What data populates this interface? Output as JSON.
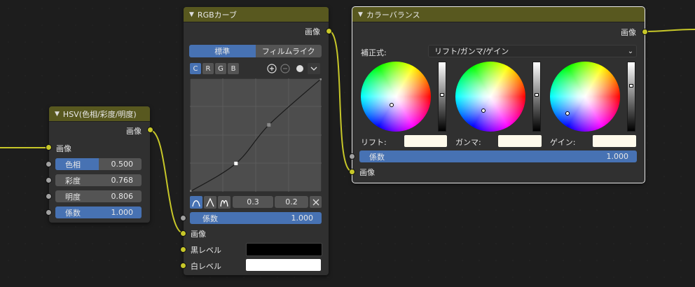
{
  "colors": {
    "header": "#58581f",
    "node_bg": "#303030",
    "accent_blue": "#4772b3",
    "socket_yellow": "#c7c729",
    "socket_grey": "#a1a1a1",
    "wire": "#c7c729",
    "background": "#1d1d1d"
  },
  "hsv_node": {
    "title": "HSV(色相/彩度/明度)",
    "output_label": "画像",
    "input_image_label": "画像",
    "fields": [
      {
        "label": "色相",
        "value": "0.500",
        "fraction": 0.5
      },
      {
        "label": "彩度",
        "value": "0.768",
        "fraction": 0.0
      },
      {
        "label": "明度",
        "value": "0.806",
        "fraction": 0.0
      },
      {
        "label": "係数",
        "value": "1.000",
        "fraction": 1.0
      }
    ]
  },
  "rgb_node": {
    "title": "RGBカーブ",
    "output_label": "画像",
    "tabs": [
      "標準",
      "フィルムライク"
    ],
    "active_tab": "標準",
    "channels": [
      "C",
      "R",
      "G",
      "B"
    ],
    "active_channel": "C",
    "icons": [
      "zoom-in-icon",
      "zoom-out-icon",
      "circle-icon",
      "chevron-down-icon"
    ],
    "curve_points": [
      [
        0.0,
        0.0
      ],
      [
        0.35,
        0.25
      ],
      [
        0.6,
        0.59
      ],
      [
        1.0,
        1.0
      ]
    ],
    "handle_values": [
      "0.3",
      "0.2"
    ],
    "factor": {
      "label": "係数",
      "value": "1.000"
    },
    "input_image_label": "画像",
    "black_level_label": "黒レベル",
    "white_level_label": "白レベル",
    "black_color": "#000000",
    "white_color": "#ffffff"
  },
  "color_balance_node": {
    "title": "カラーバランス",
    "output_label": "画像",
    "formula_label": "補正式:",
    "formula_value": "リフト/ガンマ/ゲイン",
    "wheels": [
      {
        "label": "リフト:",
        "slider_level": 0.47,
        "swatch": "#fffaeb"
      },
      {
        "label": "ガンマ:",
        "slider_level": 0.47,
        "swatch": "#fffaeb"
      },
      {
        "label": "ゲイン:",
        "slider_level": 0.33,
        "swatch": "#fffaeb"
      }
    ],
    "factor": {
      "label": "係数",
      "value": "1.000"
    },
    "input_image_label": "画像"
  }
}
